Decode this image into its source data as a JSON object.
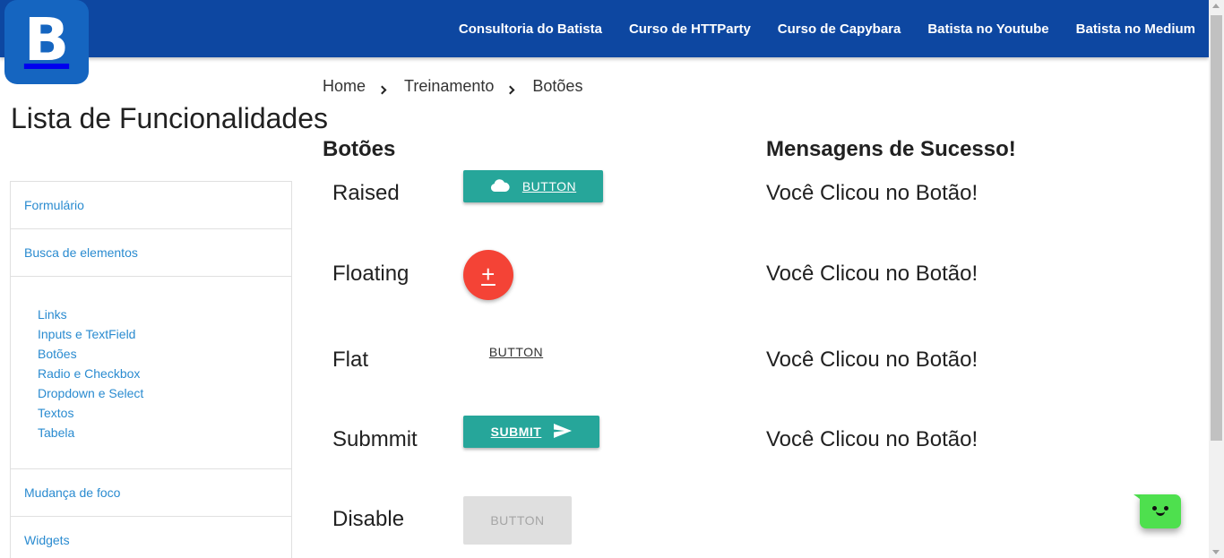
{
  "header": {
    "logo_letter": "B",
    "nav": [
      "Consultoria do Batista",
      "Curso de HTTParty",
      "Curso de Capybara",
      "Batista no Youtube",
      "Batista no Medium"
    ],
    "bg_color": "#0d47a1"
  },
  "sidebar": {
    "title": "Lista de Funcionalidades",
    "items": {
      "formulario": "Formulário",
      "busca": "Busca de elementos",
      "mudanca": "Mudança de foco",
      "widgets": "Widgets"
    },
    "subitems": [
      "Links",
      "Inputs e TextField",
      "Botões",
      "Radio e Checkbox",
      "Dropdown e Select",
      "Textos",
      "Tabela"
    ],
    "link_color": "#2a8bd0"
  },
  "breadcrumb": [
    "Home",
    "Treinamento",
    "Botões"
  ],
  "main": {
    "left_title": "Botões",
    "right_title": "Mensagens de Sucesso!",
    "rows": [
      {
        "label": "Raised",
        "button": "BUTTON",
        "icon": "cloud-icon",
        "message": "Você Clicou no Botão!"
      },
      {
        "label": "Floating",
        "button": "+",
        "icon": "plus-icon",
        "message": "Você Clicou no Botão!"
      },
      {
        "label": "Flat",
        "button": "BUTTON",
        "message": "Você Clicou no Botão!"
      },
      {
        "label": "Submmit",
        "button": "SUBMIT",
        "icon": "send-icon",
        "message": "Você Clicou no Botão!"
      },
      {
        "label": "Disable",
        "button": "BUTTON"
      }
    ],
    "colors": {
      "teal": "#26a69a",
      "red": "#f44336",
      "disabled": "#dfdfdf"
    }
  },
  "chat_widget": {
    "icon": "chat-bot-icon",
    "color": "#4ee04e"
  }
}
